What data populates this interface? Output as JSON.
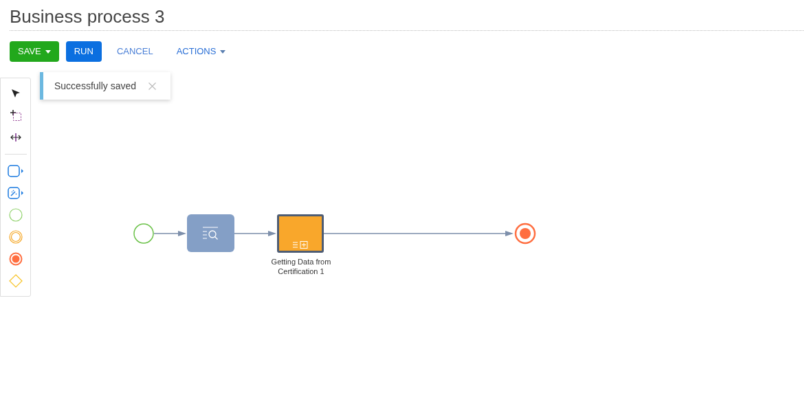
{
  "title": "Business process 3",
  "toolbar": [
    {
      "label": "SAVE",
      "kind": "primary-dropdown"
    },
    {
      "label": "RUN",
      "kind": "primary"
    },
    {
      "label": "CANCEL",
      "kind": "link"
    },
    {
      "label": "ACTIONS",
      "kind": "link-dropdown"
    }
  ],
  "notification": {
    "text": "Successfully saved"
  },
  "palette": [
    {
      "kind": "pointer"
    },
    {
      "kind": "lasso"
    },
    {
      "kind": "space"
    },
    {
      "kind": "divider"
    },
    {
      "kind": "task"
    },
    {
      "kind": "auto-task"
    },
    {
      "kind": "start"
    },
    {
      "kind": "intermediate"
    },
    {
      "kind": "end"
    },
    {
      "kind": "gateway"
    }
  ],
  "diagram": {
    "nodes": [
      {
        "kind": "start"
      },
      {
        "kind": "read-data"
      },
      {
        "kind": "subprocess",
        "label": "Getting Data from Certification 1"
      },
      {
        "kind": "end"
      }
    ]
  }
}
